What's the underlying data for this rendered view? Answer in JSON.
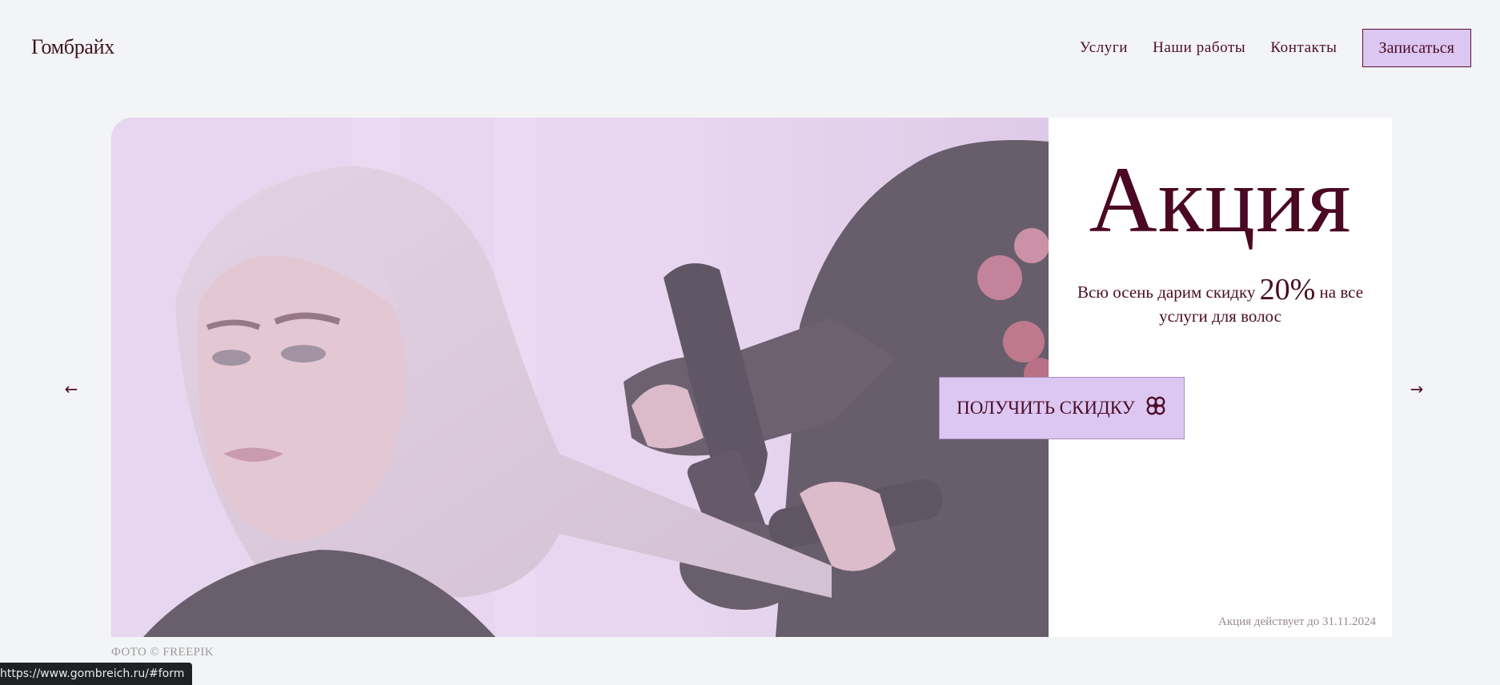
{
  "header": {
    "logo": "Гомбрайх",
    "nav": {
      "services": "Услуги",
      "works": "Наши работы",
      "contacts": "Контакты",
      "signup": "Записаться"
    }
  },
  "carousel": {
    "prev_icon": "arrow-left-icon",
    "next_icon": "arrow-right-icon",
    "prev_glyph": "←",
    "next_glyph": "→"
  },
  "promo": {
    "title": "Акция",
    "text_before": "Всю осень дарим скидку ",
    "percent": "20%",
    "text_after": " на все услуги для волос",
    "button_label": "ПОЛУЧИТЬ СКИДКУ",
    "button_icon": "flower-icon",
    "validity": "Акция действует до 31.11.2024"
  },
  "photo_caption": "ФОТО © FREEPIK",
  "status_url": "https://www.gombreich.ru/#form",
  "colors": {
    "accent": "#dcc6f2",
    "text": "#4a0d25",
    "background": "#f3f4f6"
  }
}
